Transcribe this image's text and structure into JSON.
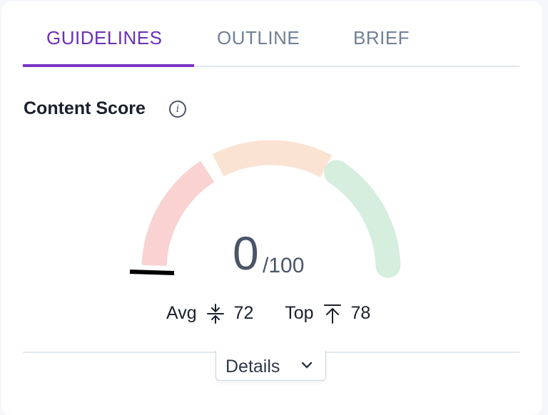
{
  "tabs": [
    {
      "label": "GUIDELINES",
      "active": true
    },
    {
      "label": "OUTLINE",
      "active": false
    },
    {
      "label": "BRIEF",
      "active": false
    }
  ],
  "content_score": {
    "title": "Content Score",
    "info_icon": "info-icon",
    "score": "0",
    "max": "/100",
    "gauge": {
      "min": 0,
      "max": 100,
      "value": 0,
      "segments": [
        {
          "name": "low",
          "color": "#fad2d2"
        },
        {
          "name": "medium",
          "color": "#fbe3d3"
        },
        {
          "name": "high",
          "color": "#d6eedd"
        }
      ],
      "needle_color": "#000000"
    },
    "avg_label": "Avg",
    "avg_icon": "compress-arrows-icon",
    "avg_value": "72",
    "top_label": "Top",
    "top_icon": "arrow-up-to-line-icon",
    "top_value": "78"
  },
  "details_button": {
    "label": "Details",
    "icon": "chevron-down-icon"
  },
  "colors": {
    "accent": "#7b35c8",
    "tab_inactive": "#718096",
    "text": "#1a202c"
  }
}
